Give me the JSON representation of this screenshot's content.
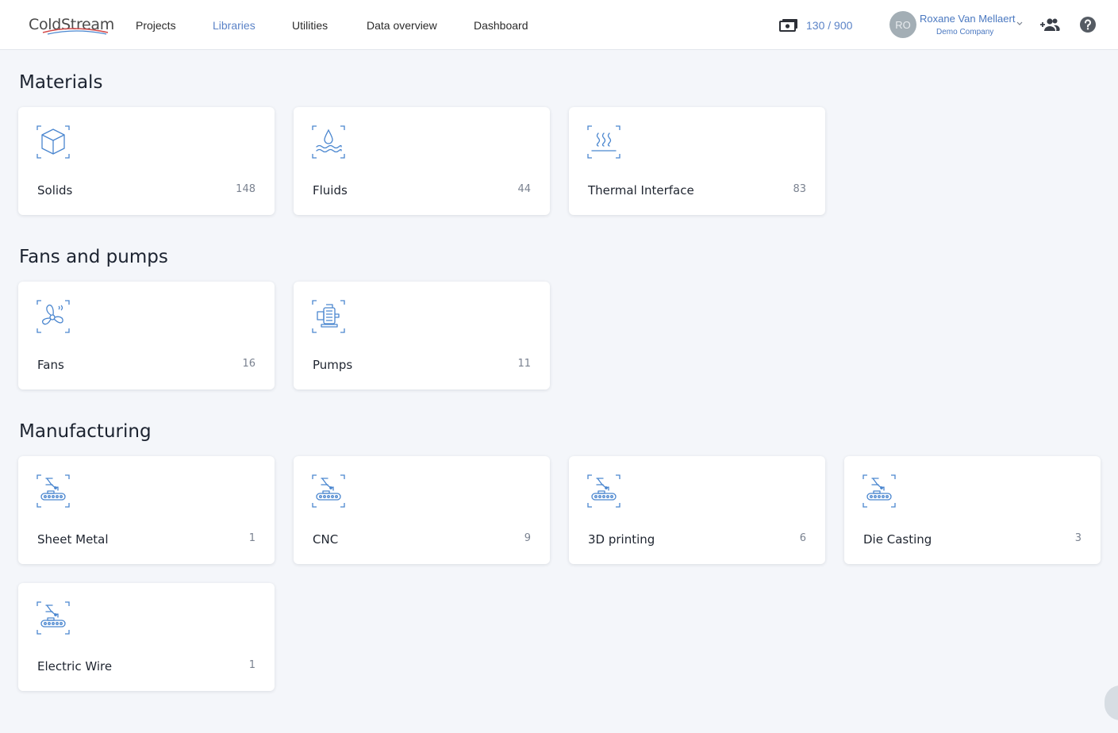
{
  "app": {
    "logo_text": "ColdStream",
    "accent": "#5b83c7"
  },
  "nav": {
    "items": [
      {
        "label": "Projects",
        "active": false
      },
      {
        "label": "Libraries",
        "active": true
      },
      {
        "label": "Utilities",
        "active": false
      },
      {
        "label": "Data overview",
        "active": false
      },
      {
        "label": "Dashboard",
        "active": false
      }
    ]
  },
  "credits": {
    "icon": "money-icon",
    "text": "130 / 900"
  },
  "user": {
    "initials": "RO",
    "name": "Roxane Van Mellaert",
    "company": "Demo Company"
  },
  "sections": [
    {
      "title": "Materials",
      "cards": [
        {
          "label": "Solids",
          "count": "148",
          "icon": "cube-icon"
        },
        {
          "label": "Fluids",
          "count": "44",
          "icon": "droplet-icon"
        },
        {
          "label": "Thermal Interface",
          "count": "83",
          "icon": "heat-icon"
        }
      ]
    },
    {
      "title": "Fans and pumps",
      "cards": [
        {
          "label": "Fans",
          "count": "16",
          "icon": "fan-icon"
        },
        {
          "label": "Pumps",
          "count": "11",
          "icon": "pump-icon"
        }
      ]
    },
    {
      "title": "Manufacturing",
      "cards": [
        {
          "label": "Sheet Metal",
          "count": "1",
          "icon": "robot-arm-icon"
        },
        {
          "label": "CNC",
          "count": "9",
          "icon": "robot-arm-icon"
        },
        {
          "label": "3D printing",
          "count": "6",
          "icon": "robot-arm-icon"
        },
        {
          "label": "Die Casting",
          "count": "3",
          "icon": "robot-arm-icon"
        },
        {
          "label": "Electric Wire",
          "count": "1",
          "icon": "robot-arm-icon"
        }
      ]
    }
  ]
}
